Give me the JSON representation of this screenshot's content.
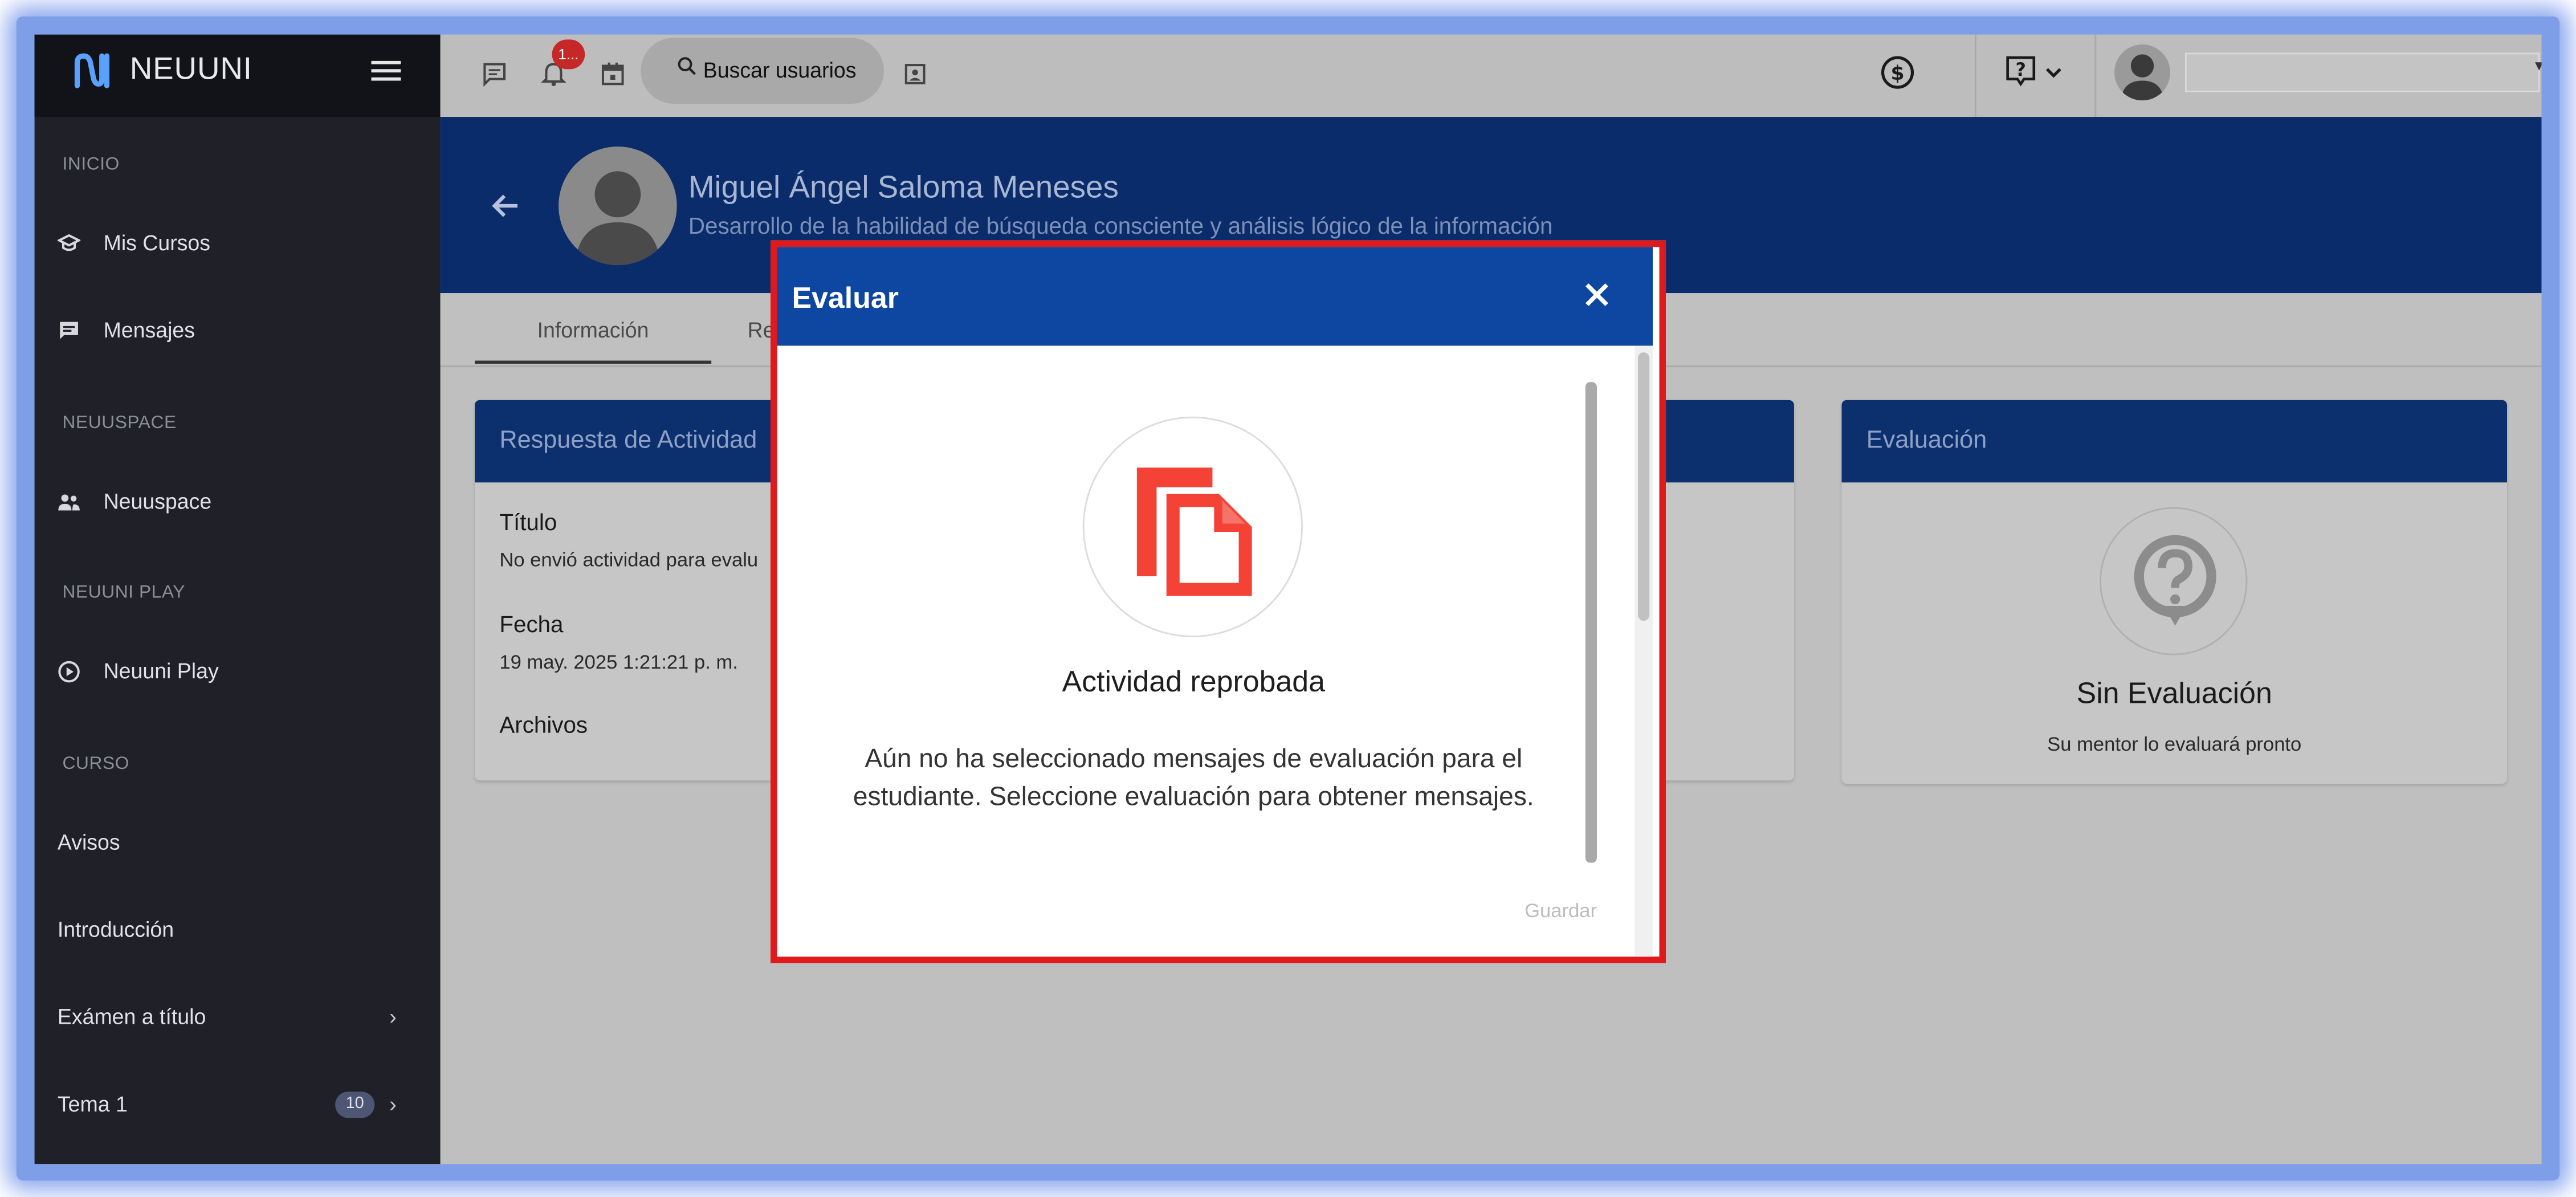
{
  "sidebar": {
    "brand": "NEUUNI",
    "sections": {
      "inicio": "INICIO",
      "neuuspace": "NEUUSPACE",
      "neuuni_play": "NEUUNI PLAY",
      "curso": "CURSO"
    },
    "items": {
      "mis_cursos": "Mis Cursos",
      "mensajes": "Mensajes",
      "neuuspace": "Neuuspace",
      "neuuni_play": "Neuuni Play",
      "avisos": "Avisos",
      "introduccion": "Introducción",
      "examen": "Exámen a título",
      "tema1": "Tema 1",
      "tema1_badge": "10"
    }
  },
  "topbar": {
    "notification_count": "1...",
    "search_label": "Buscar usuarios"
  },
  "student": {
    "name": "Miguel Ángel Saloma Meneses",
    "course": "Desarrollo de la habilidad de búsqueda consciente y análisis lógico de la información"
  },
  "tabs": {
    "info": "Información",
    "second": "Re"
  },
  "response_card": {
    "title": "Respuesta de Actividad",
    "titulo_label": "Título",
    "titulo_value": "No envió actividad para evalu",
    "fecha_label": "Fecha",
    "fecha_value": "19 may. 2025 1:21:21 p. m.",
    "archivos_label": "Archivos"
  },
  "evaluation_card": {
    "title": "Evaluación",
    "status": "Sin Evaluación",
    "note": "Su mentor lo evaluará pronto"
  },
  "modal": {
    "title": "Evaluar",
    "result": "Actividad reprobada",
    "message": "Aún no ha seleccionado mensajes de evaluación para el estudiante. Seleccione evaluación para obtener mensajes.",
    "save_label": "Guardar"
  },
  "colors": {
    "modal_header": "#0d47a1",
    "highlight_border": "#e0191c",
    "doc_icon": "#f44336",
    "sidebar_bg": "#1f2028"
  }
}
